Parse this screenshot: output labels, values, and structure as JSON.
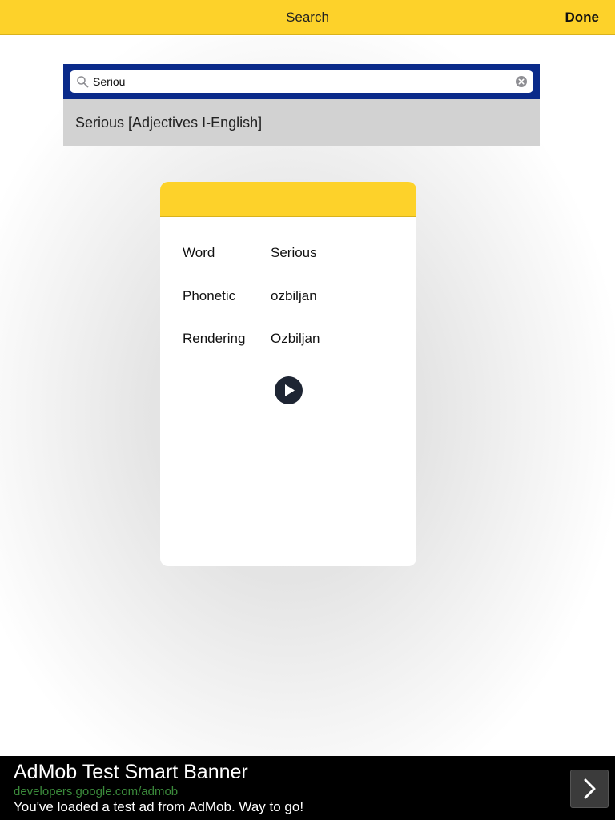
{
  "navbar": {
    "title": "Search",
    "done_label": "Done"
  },
  "search": {
    "value": "Seriou"
  },
  "results": [
    {
      "text": "Serious [Adjectives I-English]"
    }
  ],
  "card": {
    "rows": [
      {
        "label": "Word",
        "value": "Serious"
      },
      {
        "label": "Phonetic",
        "value": "ozbiljan"
      },
      {
        "label": "Rendering",
        "value": "Ozbiljan"
      }
    ],
    "play_icon": "play-icon"
  },
  "ad": {
    "title": "AdMob Test Smart Banner",
    "url": "developers.google.com/admob",
    "description": "You've loaded a test ad from AdMob. Way to go!",
    "arrow_icon": "chevron-right-icon"
  },
  "colors": {
    "accent": "#fdd22a",
    "search_bar": "#0a2a8a",
    "ad_url": "#3b8a3b"
  }
}
